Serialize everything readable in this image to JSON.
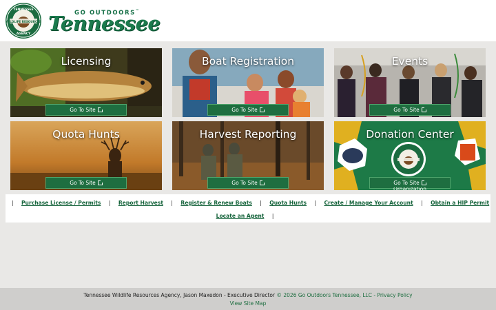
{
  "header": {
    "seal_text_top": "TENNESSEE",
    "seal_text_mid": "WILDLIFE RESOURCES",
    "seal_text_bottom": "AGENCY",
    "brand_small": "GO OUTDOORS",
    "brand_tm": "™",
    "brand_big": "Tennessee"
  },
  "tiles": [
    {
      "title": "Licensing",
      "button": "Go To Site",
      "icon": "fish-image"
    },
    {
      "title": "Boat Registration",
      "button": "Go To Site",
      "icon": "boating-family-image"
    },
    {
      "title": "Events",
      "button": "Go To Site",
      "icon": "archery-image"
    },
    {
      "title": "Quota Hunts",
      "button": "Go To Site",
      "icon": "deer-image"
    },
    {
      "title": "Harvest Reporting",
      "button": "Go To Site",
      "icon": "hunters-image"
    },
    {
      "title": "Donation Center",
      "button": "Go To Site",
      "icon": "merchandise-image",
      "overlay_text": "Organization"
    }
  ],
  "quick_links": {
    "row1": [
      "Purchase License / Permits",
      "Report Harvest",
      "Register & Renew Boats",
      "Quota Hunts",
      "Create / Manage Your Account",
      "Obtain a HIP Permit"
    ],
    "row2": [
      "Locate an Agent"
    ],
    "separator": "|"
  },
  "footer": {
    "agency_text": "Tennessee Wildlife Resources Agency, Jason Maxedon - Executive Director",
    "copyright": "© 2026 Go Outdoors Tennessee, LLC",
    "dash": " - ",
    "privacy": "Privacy Policy",
    "sitemap": "View Site Map"
  },
  "colors": {
    "brand_green": "#1b7a4d",
    "button_green": "#1e6e40",
    "background": "#e9e8e6"
  }
}
